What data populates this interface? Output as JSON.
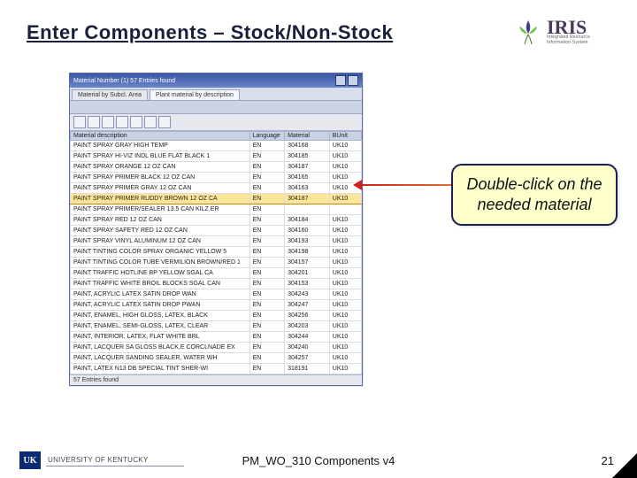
{
  "header": {
    "title": "Enter Components – Stock/Non-Stock",
    "logo_brand": "IRIS",
    "logo_sub": "Integrated Resource Information System"
  },
  "sap": {
    "title": "Material Number (1)   57 Entries found",
    "tabs": [
      {
        "label": "Material by Subcl. Area",
        "active": false
      },
      {
        "label": "Plant material by description",
        "active": true
      }
    ],
    "columns": {
      "desc": "Material description",
      "lang": "Language",
      "mat": "Material",
      "unit": "BUnit"
    },
    "rows": [
      {
        "desc": "PAINT SPRAY GRAY HIGH TEMP",
        "lang": "EN",
        "mat": "304168",
        "unit": "UK10"
      },
      {
        "desc": "PAINT SPRAY HI-VIZ INDL BLUE FLAT BLACK 1",
        "lang": "EN",
        "mat": "304185",
        "unit": "UK10"
      },
      {
        "desc": "PAINT SPRAY ORANGE 12 OZ CAN",
        "lang": "EN",
        "mat": "304187",
        "unit": "UK10"
      },
      {
        "desc": "PAINT SPRAY PRIMER BLACK 12 OZ CAN",
        "lang": "EN",
        "mat": "304165",
        "unit": "UK10"
      },
      {
        "desc": "PAINT SPRAY PRIMER GRAY 12 OZ CAN",
        "lang": "EN",
        "mat": "304163",
        "unit": "UK10"
      },
      {
        "desc": "PAINT SPRAY PRIMER RUDDY BROWN 12 OZ CA",
        "lang": "EN",
        "mat": "304187",
        "unit": "UK10",
        "highlight": true
      },
      {
        "desc": "PAINT SPRAY PRIMER/SEALER 13.5 CAN KILZ ER",
        "lang": "EN",
        "mat": "",
        "unit": ""
      },
      {
        "desc": "PAINT SPRAY RED 12 OZ CAN",
        "lang": "EN",
        "mat": "304184",
        "unit": "UK10"
      },
      {
        "desc": "PAINT SPRAY SAFETY RED 12 OZ CAN",
        "lang": "EN",
        "mat": "304160",
        "unit": "UK10"
      },
      {
        "desc": "PAINT SPRAY VINYL ALUMINUM 12 OZ CAN",
        "lang": "EN",
        "mat": "304193",
        "unit": "UK10"
      },
      {
        "desc": "PAINT TINTING COLOR SPRAY ORGANIC YELLOW 5",
        "lang": "EN",
        "mat": "304198",
        "unit": "UK10"
      },
      {
        "desc": "PAINT TINTING COLOR TUBE VERMILION BROWN/RED 1",
        "lang": "EN",
        "mat": "304157",
        "unit": "UK10"
      },
      {
        "desc": "PAINT TRAFFIC HOTLINE BP YELLOW SGAL CA",
        "lang": "EN",
        "mat": "304201",
        "unit": "UK10"
      },
      {
        "desc": "PAINT TRAFFIC WHITE BROIL BLOCKS SGAL CAN",
        "lang": "EN",
        "mat": "304153",
        "unit": "UK10"
      },
      {
        "desc": "PAINT, ACRYLIC LATEX SATIN DROP WAN",
        "lang": "EN",
        "mat": "304243",
        "unit": "UK10"
      },
      {
        "desc": "PAINT, ACRYLIC LATEX SATIN DROP PWAN",
        "lang": "EN",
        "mat": "304247",
        "unit": "UK10"
      },
      {
        "desc": "PAINT, ENAMEL, HIGH GLOSS, LATEX, BLACK",
        "lang": "EN",
        "mat": "304256",
        "unit": "UK10"
      },
      {
        "desc": "PAINT, ENAMEL, SEMI-GLOSS, LATEX, CLEAR",
        "lang": "EN",
        "mat": "304203",
        "unit": "UK10"
      },
      {
        "desc": "PAINT, INTERIOR, LATEX, FLAT WHITE BRL",
        "lang": "EN",
        "mat": "304244",
        "unit": "UK10"
      },
      {
        "desc": "PAINT, LACQUER SA GLOSS BLACK,E CORCLNADE EX",
        "lang": "EN",
        "mat": "304240",
        "unit": "UK10"
      },
      {
        "desc": "PAINT, LACQUER SANDING SEALER, WATER WH",
        "lang": "EN",
        "mat": "304257",
        "unit": "UK10"
      },
      {
        "desc": "PAINT, LATEX N13 DB SPECIAL TINT SHER-WI",
        "lang": "EN",
        "mat": "318191",
        "unit": "UK10"
      }
    ],
    "status": "57 Entries found"
  },
  "callout": {
    "text": "Double-click on the needed material"
  },
  "footer": {
    "uk_badge": "UK",
    "uk_text": "UNIVERSITY OF KENTUCKY",
    "center": "PM_WO_310 Components v4",
    "page": "21"
  }
}
